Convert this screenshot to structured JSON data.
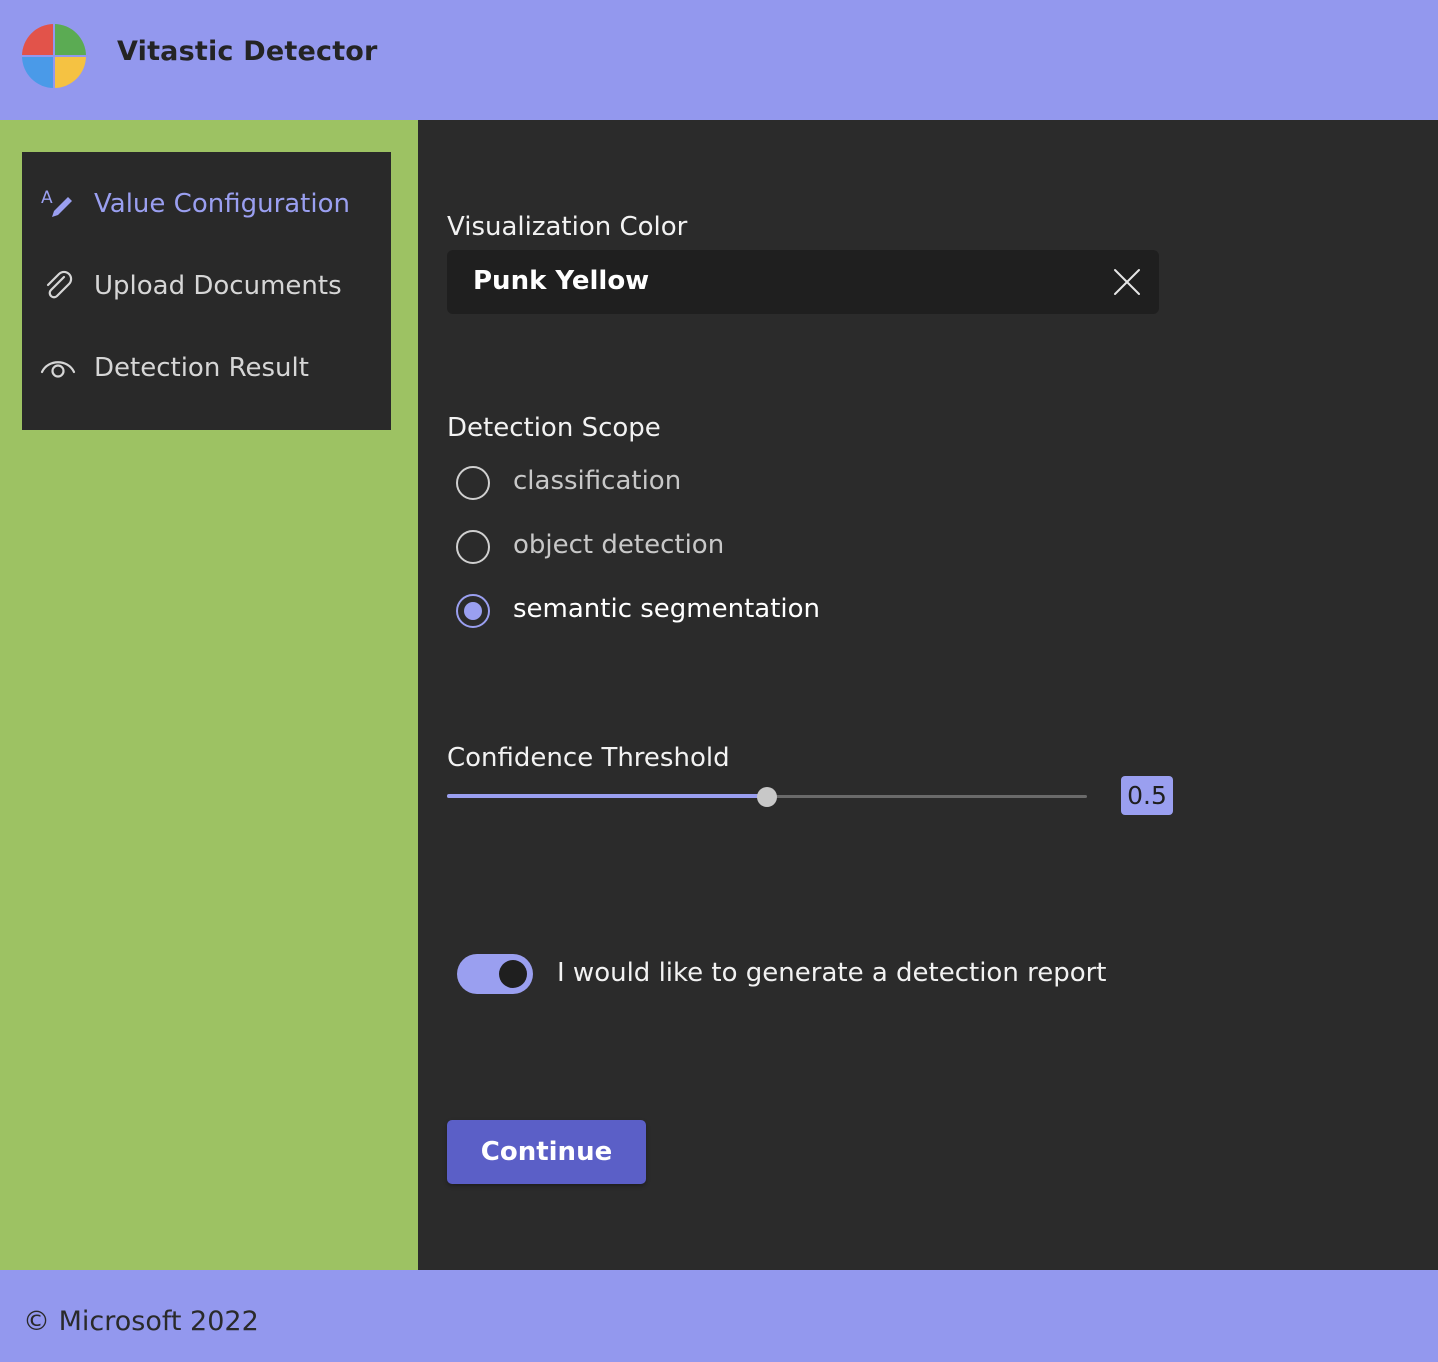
{
  "header": {
    "title": "Vitastic Detector"
  },
  "nav": {
    "items": [
      {
        "label": "Value Configuration",
        "icon": "text-edit-icon",
        "active": true
      },
      {
        "label": "Upload Documents",
        "icon": "paperclip-icon",
        "active": false
      },
      {
        "label": "Detection Result",
        "icon": "eye-icon",
        "active": false
      }
    ]
  },
  "form": {
    "color": {
      "label": "Visualization Color",
      "value": "Punk Yellow"
    },
    "scope": {
      "label": "Detection Scope",
      "options": [
        "classification",
        "object detection",
        "semantic segmentation"
      ],
      "selected": "semantic segmentation"
    },
    "threshold": {
      "label": "Confidence Threshold",
      "value": "0.5",
      "fraction": 0.5
    },
    "report": {
      "label": "I would like to generate a detection report",
      "checked": true
    },
    "continue_label": "Continue"
  },
  "footer": {
    "text": "© Microsoft 2022"
  },
  "colors": {
    "accent": "#9a9ff0",
    "brand_bar": "#9398ee",
    "sidebar": "#9dc263",
    "button": "#5b5fc7",
    "panel": "#2b2b2b"
  }
}
